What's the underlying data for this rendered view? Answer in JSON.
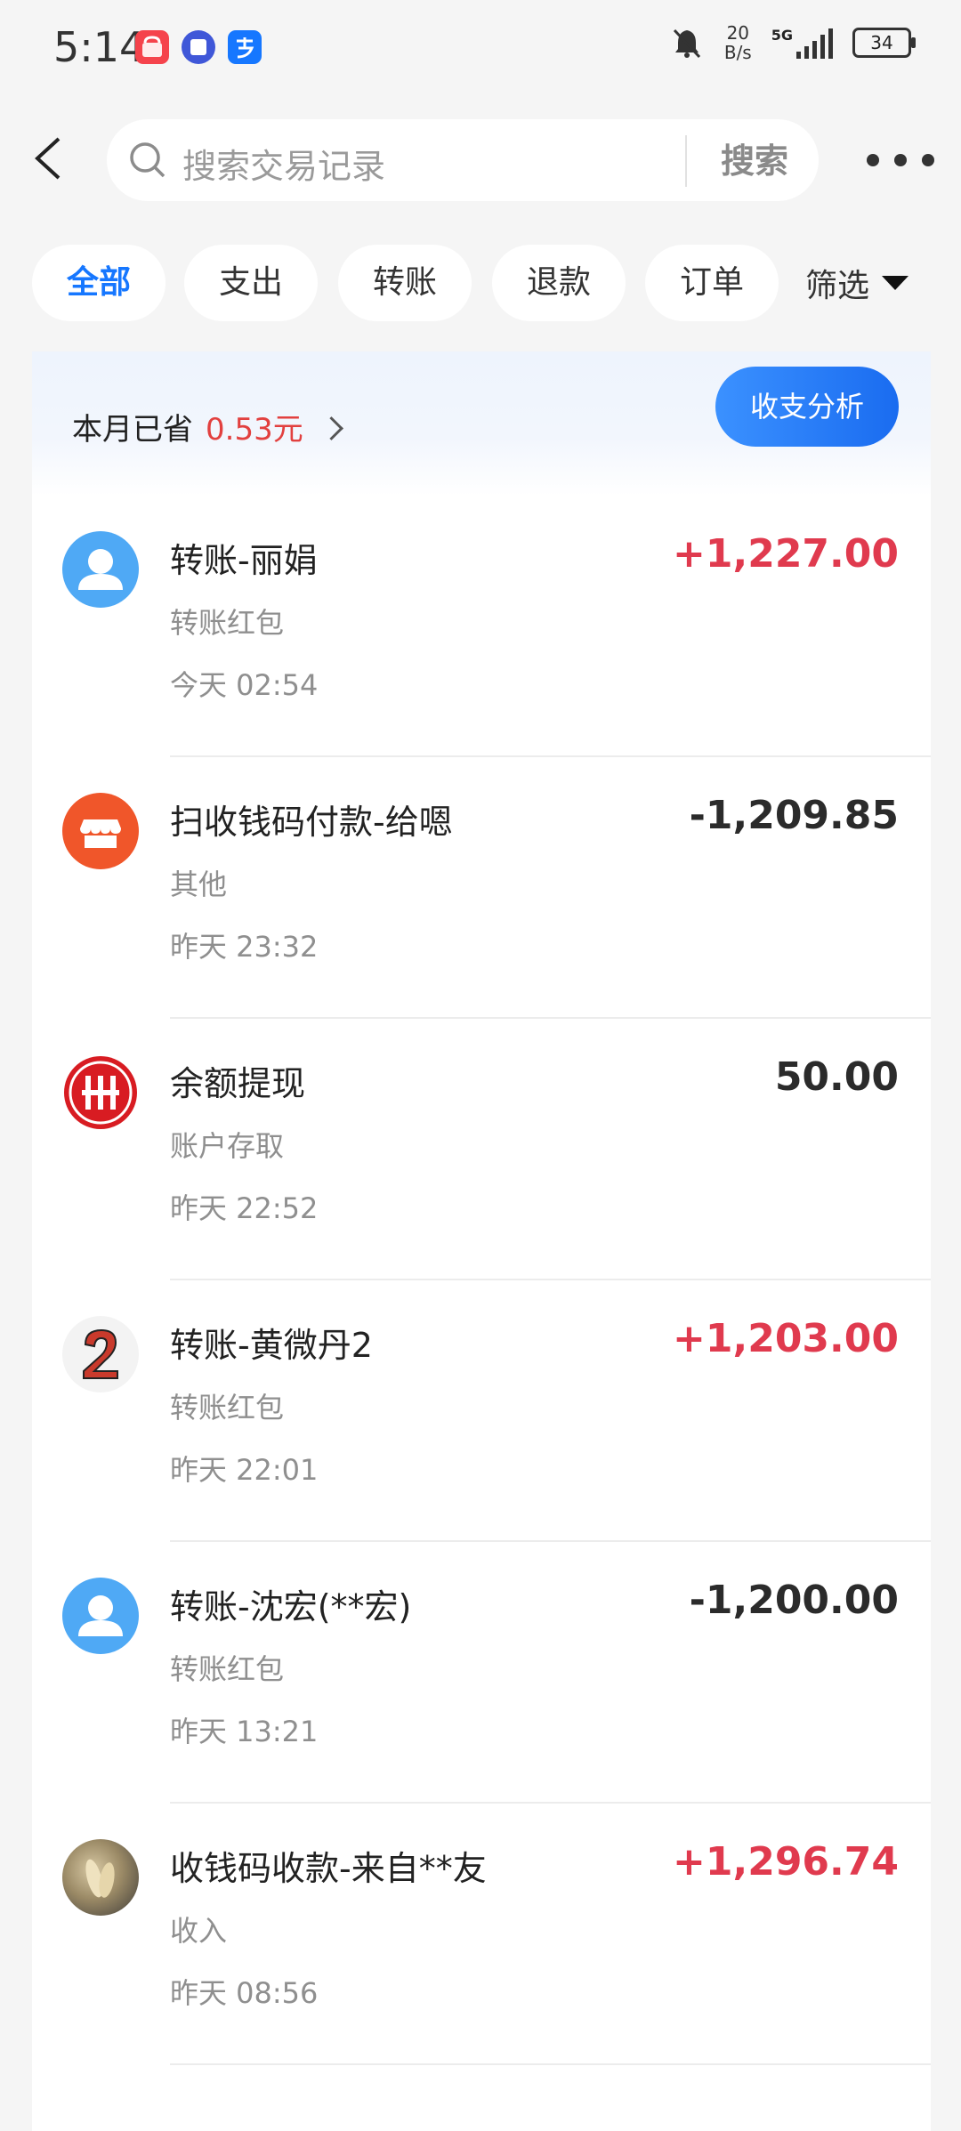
{
  "status_bar": {
    "time": "5:14",
    "net_speed_value": "20",
    "net_speed_unit": "B/s",
    "network_type": "5G",
    "battery_level": "34"
  },
  "header": {
    "search_placeholder": "搜索交易记录",
    "search_button_label": "搜索"
  },
  "tabs": [
    {
      "label": "全部",
      "active": true
    },
    {
      "label": "支出"
    },
    {
      "label": "转账"
    },
    {
      "label": "退款"
    },
    {
      "label": "订单"
    }
  ],
  "filter_label": "筛选",
  "summary": {
    "saved_label": "本月已省",
    "saved_amount": "0.53元",
    "analysis_button_label": "收支分析"
  },
  "transactions": [
    {
      "title": "转账-丽娟",
      "category": "转账红包",
      "time": "今天 02:54",
      "amount": "+1,227.00",
      "avatar": "person-avatar-icon"
    },
    {
      "title": "扫收钱码付款-给嗯",
      "category": "其他",
      "time": "昨天 23:32",
      "amount": "-1,209.85",
      "avatar": "store-icon"
    },
    {
      "title": "余额提现",
      "category": "账户存取",
      "time": "昨天 22:52",
      "amount": "50.00",
      "avatar": "bank-logo-icon"
    },
    {
      "title": "转账-黄微丹2",
      "category": "转账红包",
      "time": "昨天 22:01",
      "amount": "+1,203.00",
      "avatar": "number-two-avatar"
    },
    {
      "title": "转账-沈宏(**宏)",
      "category": "转账红包",
      "time": "昨天 13:21",
      "amount": "-1,200.00",
      "avatar": "person-avatar-icon"
    },
    {
      "title": "收钱码收款-来自**友",
      "category": "收入",
      "time": "昨天 08:56",
      "amount": "+1,296.74",
      "avatar": "photo-avatar"
    }
  ],
  "colors": {
    "accent": "#1677ff",
    "income": "#e03a4e",
    "saved_amount": "#e2403f",
    "store_icon_bg": "#f0562a",
    "bank_logo": "#d81c22",
    "person_avatar_bg": "#4fa9f5"
  }
}
